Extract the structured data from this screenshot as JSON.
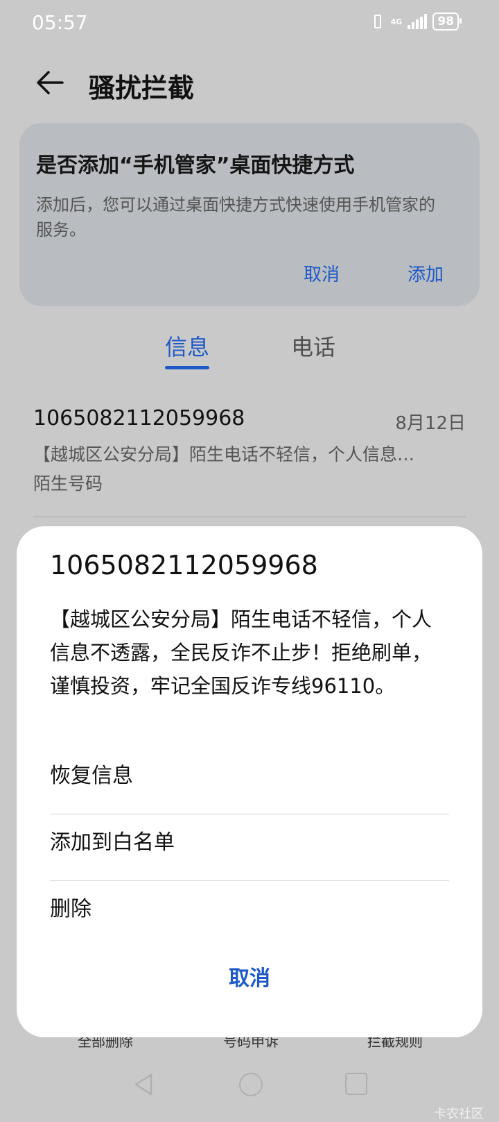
{
  "status_bar": {
    "time": "05:57",
    "network": "4G",
    "battery": "98"
  },
  "header": {
    "title": "骚扰拦截"
  },
  "shortcut_card": {
    "title": "是否添加“手机管家”桌面快捷方式",
    "description": "添加后，您可以通过桌面快捷方式快速使用手机管家的服务。",
    "cancel_label": "取消",
    "add_label": "添加"
  },
  "tabs": [
    {
      "label": "信息",
      "active": true
    },
    {
      "label": "电话",
      "active": false
    }
  ],
  "messages": [
    {
      "number": "1065082112059968",
      "date": "8月12日",
      "preview": "【越城区公安分局】陌生电话不轻信，个人信息…",
      "tag": "陌生号码"
    }
  ],
  "bottom_bar": {
    "items": [
      "全部删除",
      "号码申诉",
      "拦截规则"
    ]
  },
  "sheet": {
    "number": "1065082112059968",
    "body": "【越城区公安分局】陌生电话不轻信，个人信息不透露，全民反诈不止步！拒绝刷单，谨慎投资，牢记全国反诈专线96110。",
    "options": [
      "恢复信息",
      "添加到白名单",
      "删除"
    ],
    "cancel_label": "取消"
  },
  "watermark": "卡农社区",
  "colors": {
    "accent": "#1e59c8",
    "background": "#c9c9c9",
    "card": "#b9bdc1",
    "sheet": "#ffffff"
  }
}
